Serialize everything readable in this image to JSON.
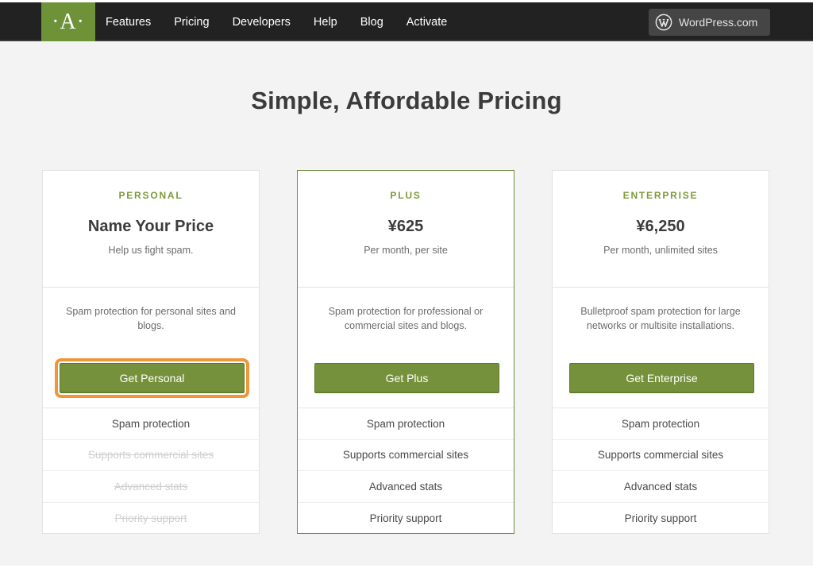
{
  "nav": {
    "logo": "·A·",
    "links": [
      "Features",
      "Pricing",
      "Developers",
      "Help",
      "Blog",
      "Activate"
    ],
    "wp_button": "WordPress.com"
  },
  "page": {
    "title": "Simple, Affordable Pricing"
  },
  "colors": {
    "accent": "#76913c",
    "highlight": "#f0953a",
    "nav_bg": "#222222"
  },
  "plans": [
    {
      "name": "PERSONAL",
      "price": "Name Your Price",
      "sub": "Help us fight spam.",
      "description": "Spam protection for personal sites and blogs.",
      "cta": "Get Personal",
      "features": [
        {
          "label": "Spam protection",
          "enabled": true
        },
        {
          "label": "Supports commercial sites",
          "enabled": false
        },
        {
          "label": "Advanced stats",
          "enabled": false
        },
        {
          "label": "Priority support",
          "enabled": false
        }
      ]
    },
    {
      "name": "PLUS",
      "price": "¥625",
      "sub": "Per month, per site",
      "description": "Spam protection for professional or commercial sites and blogs.",
      "cta": "Get Plus",
      "features": [
        {
          "label": "Spam protection",
          "enabled": true
        },
        {
          "label": "Supports commercial sites",
          "enabled": true
        },
        {
          "label": "Advanced stats",
          "enabled": true
        },
        {
          "label": "Priority support",
          "enabled": true
        }
      ]
    },
    {
      "name": "ENTERPRISE",
      "price": "¥6,250",
      "sub": "Per month, unlimited sites",
      "description": "Bulletproof spam protection for large networks or multisite installations.",
      "cta": "Get Enterprise",
      "features": [
        {
          "label": "Spam protection",
          "enabled": true
        },
        {
          "label": "Supports commercial sites",
          "enabled": true
        },
        {
          "label": "Advanced stats",
          "enabled": true
        },
        {
          "label": "Priority support",
          "enabled": true
        }
      ]
    }
  ]
}
